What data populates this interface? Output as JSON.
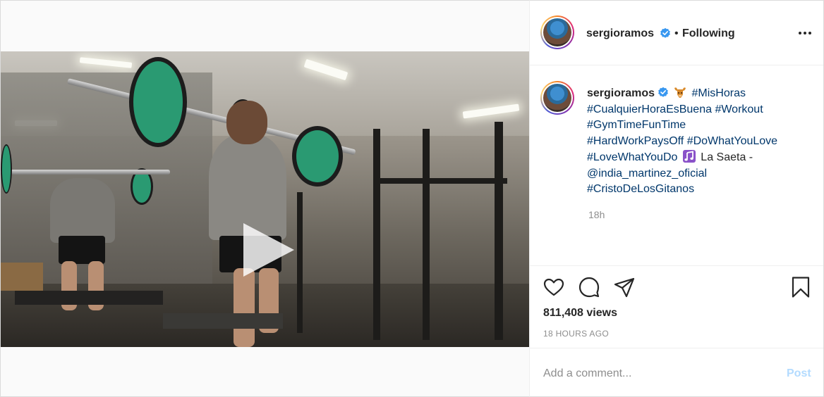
{
  "post": {
    "username": "sergioramos",
    "separator": "•",
    "follow_status": "Following",
    "caption": {
      "username": "sergioramos",
      "line1_tag": "#MisHoras",
      "line2_tag1": "#CualquierHoraEsBuena",
      "line2_tag2": "#Workout",
      "line3_tag": "#GymTimeFunTime",
      "line4_tag1": "#HardWorkPaysOff",
      "line4_tag2": "#DoWhatYouLove",
      "line5_tag": "#LoveWhatYouDo",
      "line5_text": "La Saeta -",
      "line6_mention": "@india_martinez_oficial",
      "line7_tag": "#CristoDeLosGitanos"
    },
    "caption_time": "18h",
    "views": "811,408 views",
    "date": "18 HOURS AGO"
  },
  "comment": {
    "placeholder": "Add a comment...",
    "post_label": "Post"
  },
  "colors": {
    "link_blue": "#00376b",
    "verified_blue": "#3897f0",
    "post_button_disabled": "#b3dbff",
    "muted_gray": "#8e8e8e"
  },
  "icons": {
    "verified": "verified-badge-icon",
    "more": "more-options-icon",
    "like": "heart-icon",
    "comment": "comment-icon",
    "share": "paper-plane-icon",
    "save": "bookmark-icon",
    "play": "play-icon",
    "emoji1": "flexed-bull-emoji-icon",
    "emoji2": "music-note-emoji-icon"
  }
}
